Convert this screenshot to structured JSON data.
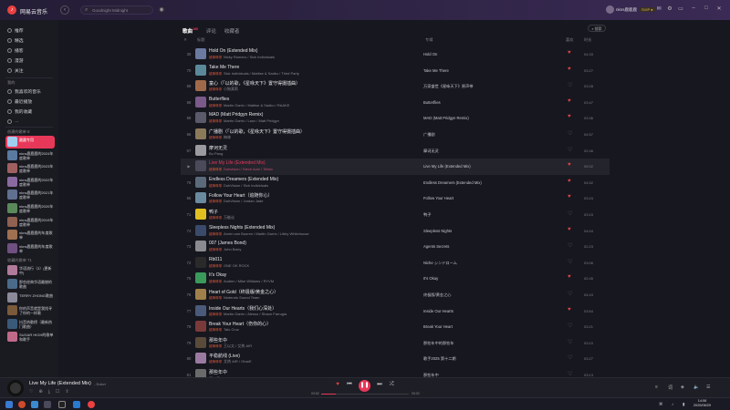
{
  "app": {
    "name": "网易云音乐",
    "logo": "netease-logo-icon"
  },
  "search": {
    "placeholder": "Goodnight Midnight"
  },
  "user": {
    "name": "nkns鹿鹿鹿",
    "vip": "SVIP ●"
  },
  "sidebar": {
    "nav": [
      {
        "label": "推荐",
        "icon": "home-icon"
      },
      {
        "label": "精选",
        "icon": "star-icon"
      },
      {
        "label": "播客",
        "icon": "podcast-icon"
      },
      {
        "label": "漫游",
        "icon": "roam-icon"
      },
      {
        "label": "关注",
        "icon": "follow-icon"
      }
    ],
    "my_header": "我的",
    "my_items": [
      {
        "label": "我喜欢的音乐",
        "icon": "heart-icon"
      },
      {
        "label": "最近播放",
        "icon": "clock-icon"
      },
      {
        "label": "我的收藏",
        "icon": "collection-icon"
      },
      {
        "label": "…",
        "icon": "more-icon"
      }
    ],
    "created_header": "创建的歌单 8",
    "created": [
      {
        "name": "圆圆专用",
        "color": "#a0d0f0"
      },
      {
        "name": "nkns鹿鹿鹿的2024年度歌单",
        "color": "#5a7aa0"
      },
      {
        "name": "nkns鹿鹿鹿的2023年度歌单",
        "color": "#a06060"
      },
      {
        "name": "nkns鹿鹿鹿的2022年度歌单",
        "color": "#8a6aa0"
      },
      {
        "name": "nkns鹿鹿鹿的2021年度歌单",
        "color": "#607090"
      },
      {
        "name": "nkns鹿鹿鹿的2020年度歌单",
        "color": "#5a8a5a"
      },
      {
        "name": "nkns鹿鹿鹿的2019年度歌单",
        "color": "#906050"
      },
      {
        "name": "nkns鹿鹿鹿的年度歌单",
        "color": "#a07050"
      },
      {
        "name": "nkns鹿鹿鹿的年度歌单",
        "color": "#705080"
      }
    ],
    "fav_header": "收藏的歌单 71",
    "fav": [
      {
        "name": "华语流行（3）(更新中)",
        "color": "#b07a9a"
      },
      {
        "name": "那些经典华语最燃的歌曲",
        "color": "#4a6a8a"
      },
      {
        "name": "TERRY ZHONG歌曲",
        "color": "#8a8a9a"
      },
      {
        "name": "你的声音就是我找寻了你的一样歌",
        "color": "#7a5a3a"
      },
      {
        "name": "抖音热歌榜（最新热门歌曲）",
        "color": "#3a5a7a"
      },
      {
        "name": "SUGAR HIGH的歌单和歌手",
        "color": "#c06a8a"
      }
    ]
  },
  "main": {
    "tabs": [
      {
        "label": "歌曲",
        "sup": "165",
        "on": true
      },
      {
        "label": "评论",
        "sup": "",
        "on": false
      },
      {
        "label": "收藏者",
        "sup": "",
        "on": false
      }
    ],
    "search_label": "⌕ 搜索",
    "columns": {
      "num": "#",
      "title": "标题",
      "album": "专辑",
      "like": "喜欢",
      "duration": "时长"
    },
    "songs": [
      {
        "idx": "30",
        "title": "Hold On (Extended Mix)",
        "tag": "超清母带",
        "artist": "Nicky Romero / Sick Individuals",
        "album": "Hold On",
        "liked": true,
        "dur": "04:33",
        "cover": "#6a7aa0"
      },
      {
        "idx": "70",
        "title": "Take Me There",
        "tag": "超清母带",
        "artist": "Sick Individuals / Mattise & Sadko / Third Party",
        "album": "Take Me There",
        "liked": true,
        "dur": "03:27",
        "cover": "#5a8a9a"
      },
      {
        "idx": "69",
        "title": "童心（「以的歌，《星咏天下》置守得摄插曲）",
        "tag": "超清母带",
        "artist": "小狗莫莉",
        "album": "万家盛世《星咏天下》原声带",
        "liked": false,
        "dur": "03:28",
        "cover": "#a06a4a"
      },
      {
        "idx": "68",
        "title": "Butterflies",
        "tag": "超清母带",
        "artist": "Martin Garrix / Mattise & Sadko / RAAKE",
        "album": "Butterflies",
        "liked": true,
        "dur": "03:47",
        "cover": "#7a5a8a"
      },
      {
        "idx": "58",
        "title": "MAD (Matt Pridgyn Remix)",
        "tag": "超清母带",
        "artist": "Martin Garrix / Lauv / Matt Pridgyn",
        "album": "MAD (Matt Pridgyn Remix)",
        "liked": true,
        "dur": "03:36",
        "cover": "#5a5a6a"
      },
      {
        "idx": "66",
        "title": "广播剧（「以的歌，《星咏天下》置守得摄插曲）",
        "tag": "超清母带",
        "artist": "梅林",
        "album": "广播剧",
        "liked": false,
        "dur": "04:57",
        "cover": "#8a7a5a"
      },
      {
        "idx": "67",
        "title": "摩诃无灵",
        "tag": "",
        "artist": "Bu Pang",
        "album": "摩诃无灵",
        "liked": false,
        "dur": "02:46",
        "cover": "#9a9aa0"
      },
      {
        "idx": "▶",
        "title": "Live My Life (Extended Mix)",
        "tag": "超清母带",
        "artist": "Dubvision / Steve Aoki / Tiësto",
        "album": "Live My Life (Extended Mix)",
        "liked": true,
        "dur": "05:02",
        "cover": "#4a4a5a",
        "hl": true
      },
      {
        "idx": "76",
        "title": "Endless Dreamers (Extended Mix)",
        "tag": "超清母带",
        "artist": "DubVision / Sick Individuals",
        "album": "Endless Dreamers (Extended Mix)",
        "liked": true,
        "dur": "04:52",
        "cover": "#5a6a7a"
      },
      {
        "idx": "65",
        "title": "Follow Your Heart（追随你心）",
        "tag": "超清母带",
        "artist": "DubVision / Jordan Jade",
        "album": "Follow Your Heart",
        "liked": true,
        "dur": "03:24",
        "cover": "#6a8aa0"
      },
      {
        "idx": "71",
        "title": "鸭子",
        "tag": "超清母带",
        "artist": "万能论",
        "album": "鸭子",
        "liked": false,
        "dur": "03:15",
        "cover": "#e0c020"
      },
      {
        "idx": "74",
        "title": "Sleepless Nights (Extended Mix)",
        "tag": "超清母带",
        "artist": "Armin van Buuren / Martin Garrix / Libby Whitehouse",
        "album": "Sleepless Nights",
        "liked": true,
        "dur": "04:04",
        "cover": "#3a4a6a"
      },
      {
        "idx": "73",
        "title": "007 (James Bond)",
        "tag": "超清母带",
        "artist": "John Barry",
        "album": "Agents Secrets",
        "liked": false,
        "dur": "02:23",
        "cover": "#8a8a90"
      },
      {
        "idx": "72",
        "title": "Rb011",
        "tag": "超清母带",
        "artist": "ONE OK ROCK",
        "album": "Niche シンドローム",
        "liked": false,
        "dur": "03:06",
        "cover": "#2a2a2a"
      },
      {
        "idx": "75",
        "title": "It's Okay",
        "tag": "超清母带",
        "artist": "Audien / Mike Williams / RYVM",
        "album": "It's Okay",
        "liked": true,
        "dur": "02:45",
        "cover": "#3a9a5a"
      },
      {
        "idx": "76",
        "title": "Heart of Gold（终极版/黄金之心）",
        "tag": "超清母带",
        "artist": "Nintendo Sound Team",
        "album": "终极版/黄金之心",
        "liked": false,
        "dur": "04:43",
        "cover": "#a0804a"
      },
      {
        "idx": "77",
        "title": "Inside Our Hearts（我们心深处）",
        "tag": "超清母带",
        "artist": "Martin Garrix / Alesso / Shaun Farrugia",
        "album": "Inside Our Hearts",
        "liked": true,
        "dur": "03:54",
        "cover": "#4a5a7a"
      },
      {
        "idx": "78",
        "title": "Break Your Heart（伤你的心）",
        "tag": "超清母带",
        "artist": "Taio Cruz",
        "album": "Break Your Heart",
        "liked": false,
        "dur": "03:21",
        "cover": "#7a3a3a"
      },
      {
        "idx": "79",
        "title": "那些年中",
        "tag": "超清母带",
        "artist": "王以太 / 艾热 AIR",
        "album": "那些年中的那些年",
        "liked": false,
        "dur": "03:10",
        "cover": "#5a4a3a"
      },
      {
        "idx": "80",
        "title": "平稳航线 (Live)",
        "tag": "超清母带",
        "artist": "艾热 AIR / GharE",
        "album": "歌手2025 第十二期",
        "liked": false,
        "dur": "03:27",
        "cover": "#9a7aa0"
      },
      {
        "idx": "81",
        "title": "那些年中",
        "tag": "",
        "artist": "GharE",
        "album": "那些年中",
        "liked": false,
        "dur": "03:13",
        "cover": "#6a6a6a"
      }
    ]
  },
  "player": {
    "title": "Live My Life (Extended Mix)",
    "artist": "- Dubvi",
    "current": "00:52",
    "total": "05:02",
    "progress": 0.17
  },
  "taskbar": {
    "time": "14:06",
    "date": "2025/06/29"
  }
}
